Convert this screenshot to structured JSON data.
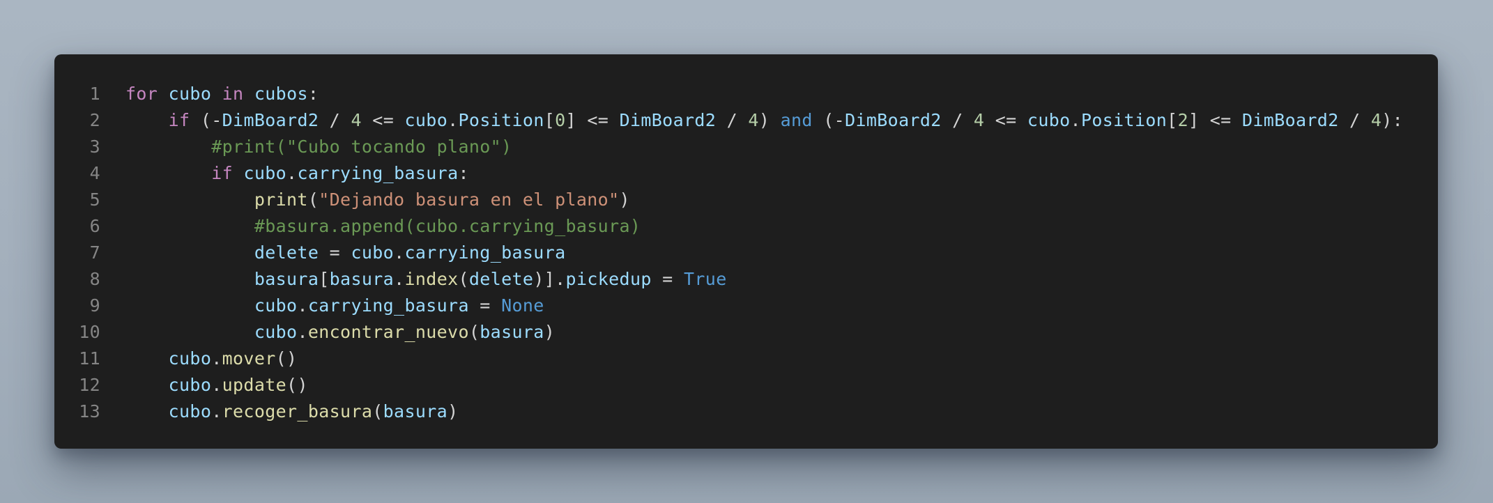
{
  "editor": {
    "language": "python",
    "theme_colors": {
      "background": "#1e1e1e",
      "page_background": "#a3afbc",
      "line_number": "#858585",
      "keyword": "#c586c0",
      "variable": "#9cdcfe",
      "number": "#b5cea8",
      "string": "#ce9178",
      "comment": "#6a9955",
      "function": "#dcdcaa",
      "constant": "#569cd6",
      "default": "#d4d4d4"
    },
    "lines": [
      {
        "number": "1",
        "tokens": [
          {
            "t": "kw",
            "v": "for"
          },
          {
            "t": "op",
            "v": " "
          },
          {
            "t": "var",
            "v": "cubo"
          },
          {
            "t": "op",
            "v": " "
          },
          {
            "t": "kw",
            "v": "in"
          },
          {
            "t": "op",
            "v": " "
          },
          {
            "t": "var",
            "v": "cubos"
          },
          {
            "t": "op",
            "v": ":"
          }
        ]
      },
      {
        "number": "2",
        "tokens": [
          {
            "t": "op",
            "v": "    "
          },
          {
            "t": "kw",
            "v": "if"
          },
          {
            "t": "op",
            "v": " (-"
          },
          {
            "t": "var",
            "v": "DimBoard2"
          },
          {
            "t": "op",
            "v": " / "
          },
          {
            "t": "num",
            "v": "4"
          },
          {
            "t": "op",
            "v": " <= "
          },
          {
            "t": "var",
            "v": "cubo"
          },
          {
            "t": "op",
            "v": "."
          },
          {
            "t": "var",
            "v": "Position"
          },
          {
            "t": "op",
            "v": "["
          },
          {
            "t": "num",
            "v": "0"
          },
          {
            "t": "op",
            "v": "] <= "
          },
          {
            "t": "var",
            "v": "DimBoard2"
          },
          {
            "t": "op",
            "v": " / "
          },
          {
            "t": "num",
            "v": "4"
          },
          {
            "t": "op",
            "v": ") "
          },
          {
            "t": "const",
            "v": "and"
          },
          {
            "t": "op",
            "v": " (-"
          },
          {
            "t": "var",
            "v": "DimBoard2"
          },
          {
            "t": "op",
            "v": " / "
          },
          {
            "t": "num",
            "v": "4"
          },
          {
            "t": "op",
            "v": " <= "
          },
          {
            "t": "var",
            "v": "cubo"
          },
          {
            "t": "op",
            "v": "."
          },
          {
            "t": "var",
            "v": "Position"
          },
          {
            "t": "op",
            "v": "["
          },
          {
            "t": "num",
            "v": "2"
          },
          {
            "t": "op",
            "v": "] <= "
          },
          {
            "t": "var",
            "v": "DimBoard2"
          },
          {
            "t": "op",
            "v": " / "
          },
          {
            "t": "num",
            "v": "4"
          },
          {
            "t": "op",
            "v": "):"
          }
        ]
      },
      {
        "number": "3",
        "tokens": [
          {
            "t": "op",
            "v": "        "
          },
          {
            "t": "cmt",
            "v": "#print(\"Cubo tocando plano\")"
          }
        ]
      },
      {
        "number": "4",
        "tokens": [
          {
            "t": "op",
            "v": "        "
          },
          {
            "t": "kw",
            "v": "if"
          },
          {
            "t": "op",
            "v": " "
          },
          {
            "t": "var",
            "v": "cubo"
          },
          {
            "t": "op",
            "v": "."
          },
          {
            "t": "var",
            "v": "carrying_basura"
          },
          {
            "t": "op",
            "v": ":"
          }
        ]
      },
      {
        "number": "5",
        "tokens": [
          {
            "t": "op",
            "v": "            "
          },
          {
            "t": "fn",
            "v": "print"
          },
          {
            "t": "op",
            "v": "("
          },
          {
            "t": "str",
            "v": "\"Dejando basura en el plano\""
          },
          {
            "t": "op",
            "v": ")"
          }
        ]
      },
      {
        "number": "6",
        "tokens": [
          {
            "t": "op",
            "v": "            "
          },
          {
            "t": "cmt",
            "v": "#basura.append(cubo.carrying_basura)"
          }
        ]
      },
      {
        "number": "7",
        "tokens": [
          {
            "t": "op",
            "v": "            "
          },
          {
            "t": "var",
            "v": "delete"
          },
          {
            "t": "op",
            "v": " = "
          },
          {
            "t": "var",
            "v": "cubo"
          },
          {
            "t": "op",
            "v": "."
          },
          {
            "t": "var",
            "v": "carrying_basura"
          }
        ]
      },
      {
        "number": "8",
        "tokens": [
          {
            "t": "op",
            "v": "            "
          },
          {
            "t": "var",
            "v": "basura"
          },
          {
            "t": "op",
            "v": "["
          },
          {
            "t": "var",
            "v": "basura"
          },
          {
            "t": "op",
            "v": "."
          },
          {
            "t": "fn",
            "v": "index"
          },
          {
            "t": "op",
            "v": "("
          },
          {
            "t": "var",
            "v": "delete"
          },
          {
            "t": "op",
            "v": ")]."
          },
          {
            "t": "var",
            "v": "pickedup"
          },
          {
            "t": "op",
            "v": " = "
          },
          {
            "t": "const",
            "v": "True"
          }
        ]
      },
      {
        "number": "9",
        "tokens": [
          {
            "t": "op",
            "v": "            "
          },
          {
            "t": "var",
            "v": "cubo"
          },
          {
            "t": "op",
            "v": "."
          },
          {
            "t": "var",
            "v": "carrying_basura"
          },
          {
            "t": "op",
            "v": " = "
          },
          {
            "t": "const",
            "v": "None"
          }
        ]
      },
      {
        "number": "10",
        "tokens": [
          {
            "t": "op",
            "v": "            "
          },
          {
            "t": "var",
            "v": "cubo"
          },
          {
            "t": "op",
            "v": "."
          },
          {
            "t": "fn",
            "v": "encontrar_nuevo"
          },
          {
            "t": "op",
            "v": "("
          },
          {
            "t": "var",
            "v": "basura"
          },
          {
            "t": "op",
            "v": ")"
          }
        ]
      },
      {
        "number": "11",
        "tokens": [
          {
            "t": "op",
            "v": "    "
          },
          {
            "t": "var",
            "v": "cubo"
          },
          {
            "t": "op",
            "v": "."
          },
          {
            "t": "fn",
            "v": "mover"
          },
          {
            "t": "op",
            "v": "()"
          }
        ]
      },
      {
        "number": "12",
        "tokens": [
          {
            "t": "op",
            "v": "    "
          },
          {
            "t": "var",
            "v": "cubo"
          },
          {
            "t": "op",
            "v": "."
          },
          {
            "t": "fn",
            "v": "update"
          },
          {
            "t": "op",
            "v": "()"
          }
        ]
      },
      {
        "number": "13",
        "tokens": [
          {
            "t": "op",
            "v": "    "
          },
          {
            "t": "var",
            "v": "cubo"
          },
          {
            "t": "op",
            "v": "."
          },
          {
            "t": "fn",
            "v": "recoger_basura"
          },
          {
            "t": "op",
            "v": "("
          },
          {
            "t": "var",
            "v": "basura"
          },
          {
            "t": "op",
            "v": ")"
          }
        ]
      }
    ]
  }
}
